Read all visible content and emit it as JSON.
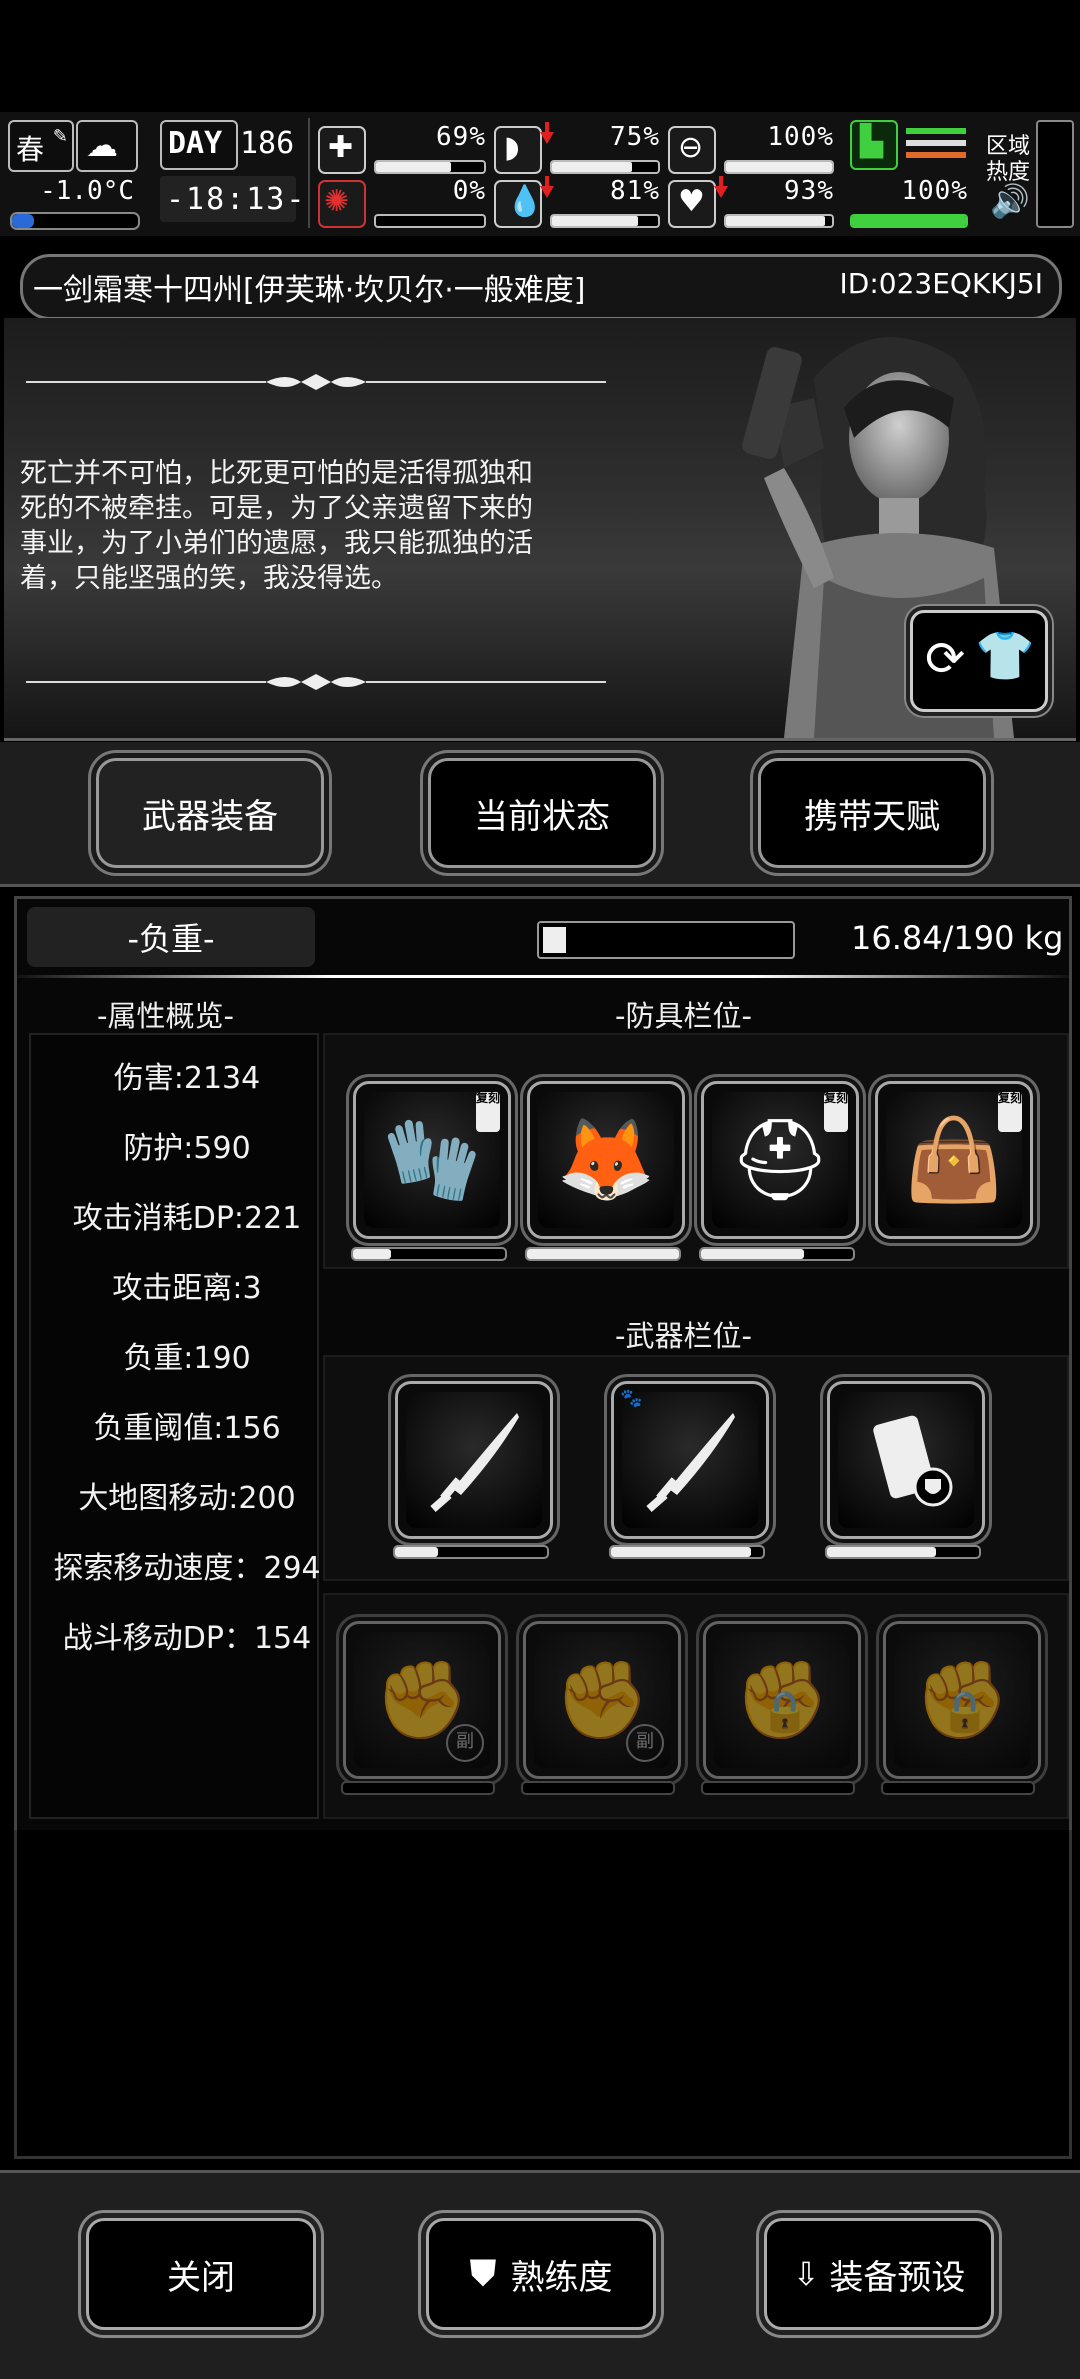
{
  "status": {
    "season": "春",
    "day_label": "DAY",
    "day": "186",
    "temperature": "-1.0°C",
    "time": "-18:13-",
    "health": {
      "value": "69%",
      "fill": 0.69
    },
    "infection": {
      "value": "0%",
      "fill": 0.0
    },
    "hunger": {
      "value": "75%",
      "fill": 0.75
    },
    "thirst": {
      "value": "81%",
      "fill": 0.81
    },
    "armor": {
      "value": "100%",
      "fill": 1.0
    },
    "mood": {
      "value": "93%",
      "fill": 0.93
    },
    "stamina": {
      "value": "100%",
      "fill": 1.0
    },
    "zone_heat_label_1": "区域",
    "zone_heat_label_2": "热度",
    "accent_green": "#3fcf3f",
    "accent_red": "#e02020"
  },
  "title": {
    "name": "一剑霜寒十四州[伊芙琳·坎贝尔·一般难度]",
    "id": "ID:023EQKKJ5I"
  },
  "story": {
    "line1": "死亡并不可怕，比死更可怕的是活得孤独和",
    "line2": "死的不被牵挂。可是，为了父亲遗留下来的",
    "line3": "事业，为了小弟们的遗愿，我只能孤独的活",
    "line4": "着，只能坚强的笑，我没得选。"
  },
  "tabs": {
    "weapons": "武器装备",
    "status": "当前状态",
    "talents": "携带天赋"
  },
  "load": {
    "label": "-负重-",
    "value": "16.84/190 kg",
    "fill": 0.09
  },
  "attributes": {
    "header": "-属性概览-",
    "items": [
      "伤害:2134",
      "防护:590",
      "攻击消耗DP:221",
      "攻击距离:3",
      "负重:190",
      "负重阈值:156",
      "大地图移动:200",
      "探索移动速度：294",
      "战斗移动DP：154"
    ]
  },
  "armor_slots": {
    "header": "-防具栏位-",
    "copy_badge": "复刻",
    "items": [
      {
        "icon": "gloves-icon",
        "durability": 0.25,
        "copy": true
      },
      {
        "icon": "hooded-suit-icon",
        "durability": 1.0,
        "copy": false
      },
      {
        "icon": "helmet-icon",
        "durability": 0.68,
        "copy": true
      },
      {
        "icon": "bag-icon",
        "durability": 0,
        "copy": true
      }
    ]
  },
  "weapon_slots": {
    "header": "-武器栏位-",
    "items": [
      {
        "icon": "katana-icon",
        "durability": 0.28
      },
      {
        "icon": "katana-icon",
        "durability": 0.92
      },
      {
        "icon": "shield-pack-icon",
        "durability": 0.72
      }
    ]
  },
  "sub_slots": {
    "sub_badge": "副"
  },
  "buttons": {
    "close": "关闭",
    "proficiency": "熟练度",
    "preset": "装备预设"
  }
}
